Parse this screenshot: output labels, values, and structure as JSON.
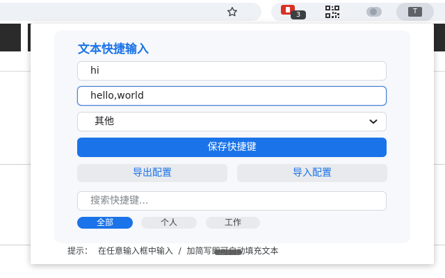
{
  "browser": {
    "extensions": {
      "badge_count": "3",
      "profile_letter": "T"
    }
  },
  "popup": {
    "title": "文本快捷输入",
    "abbreviation_value": "hi",
    "text_value": "hello,world",
    "category_selected": "其他",
    "save_label": "保存快捷键",
    "export_label": "导出配置",
    "import_label": "导入配置",
    "search_placeholder": "搜索快捷键...",
    "filters": [
      "全部",
      "个人",
      "工作"
    ],
    "hint": "提示： 在任意输入框中输入 / 加简写即可自动填充文本"
  },
  "colors": {
    "accent": "#1a73e8",
    "panel_bg": "#f6f8fb",
    "secondary_bg": "#e8eaed"
  },
  "icons": [
    "star-icon",
    "extension-red-icon",
    "qr-code-icon",
    "toggle-icon",
    "profile-icon",
    "chevron-down-icon"
  ]
}
